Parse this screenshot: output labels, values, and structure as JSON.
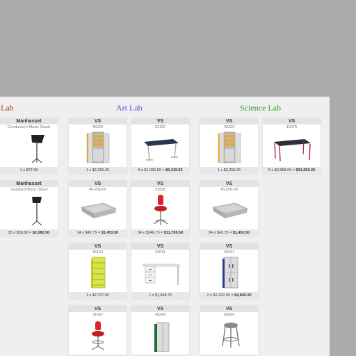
{
  "sections": {
    "left": {
      "title": "Lab",
      "color": "#b03a3a"
    },
    "art": {
      "title": "Art Lab",
      "color": "#5858e0"
    },
    "science": {
      "title": "Science Lab",
      "color": "#2e9a2e"
    }
  },
  "cards": [
    {
      "brand": "Manhasset",
      "code": "Conductor's Music Stand",
      "qty_label": "1 x $72.99",
      "total": "",
      "icon": "music-stand-icon"
    },
    {
      "brand": "Manhasset",
      "code": "Standard Music Stand",
      "qty_label": "35 x $59.50 = ",
      "total": "$2,082.50",
      "icon": "music-stand-icon"
    },
    {
      "brand": "VS",
      "code": "45229",
      "qty_label": "1 x $2,256.25",
      "total": "",
      "icon": "storage-cabinet-icon"
    },
    {
      "brand": "VS",
      "code": "22130",
      "qty_label": "9 x $1,035.50 = ",
      "total": "$9,319.50",
      "icon": "table-icon"
    },
    {
      "brand": "VS",
      "code": "45229",
      "qty_label": "1 x $2,256.25",
      "total": "",
      "icon": "storage-cabinet-icon"
    },
    {
      "brand": "VS",
      "code": "10075",
      "qty_label": "8 x $3,958.65 = ",
      "total": "$31,669.20",
      "icon": "lab-table-icon"
    },
    {
      "brand": "VS",
      "code": "45-256-00",
      "qty_label": "34 x $42.75 = ",
      "total": "$1,453.50",
      "icon": "tray-icon"
    },
    {
      "brand": "VS",
      "code": "31506",
      "qty_label": "34 x $346.75 = ",
      "total": "$11,789.50",
      "icon": "chair-icon"
    },
    {
      "brand": "VS",
      "code": "45-256-00",
      "qty_label": "34 x $42.75 = ",
      "total": "$1,453.50",
      "icon": "tray-icon"
    },
    {
      "brand": "VS",
      "code": "45163",
      "qty_label": "1 x $2,707.50",
      "total": "",
      "icon": "shelving-icon"
    },
    {
      "brand": "VS",
      "code": "23031",
      "qty_label": "1 x $1,448.75",
      "total": "",
      "icon": "desk-icon"
    },
    {
      "brand": "VS",
      "code": "45241",
      "qty_label": "2 x $2,422.50 = ",
      "total": "$4,845.00",
      "icon": "locker-cabinet-icon"
    },
    {
      "brand": "VS",
      "code": "31507",
      "qty_label": "",
      "total": "",
      "icon": "stool-chair-icon"
    },
    {
      "brand": "VS",
      "code": "45246",
      "qty_label": "",
      "total": "",
      "icon": "tall-cabinet-icon"
    },
    {
      "brand": "VS",
      "code": "03429",
      "qty_label": "",
      "total": "",
      "icon": "stool-icon"
    }
  ]
}
